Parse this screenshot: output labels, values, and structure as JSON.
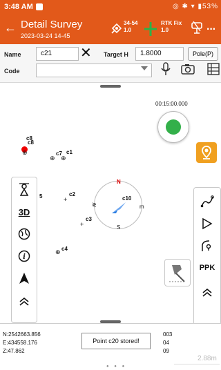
{
  "status": {
    "time": "3:48 AM",
    "right_text": "◎ ✱ ▾ ▮53%"
  },
  "header": {
    "title": "Detail Survey",
    "subtitle": "2023-03-24 14-45",
    "back_icon": "back-arrow-icon"
  },
  "satellite": {
    "count": "34-54",
    "value": "1.0"
  },
  "rtk": {
    "status": "RTK Fix",
    "value": "1.0"
  },
  "form": {
    "name_label": "Name",
    "name_value": "c21",
    "target_h_label": "Target H",
    "target_h_value": "1.8000",
    "pole_label": "Pole(P)",
    "code_label": "Code",
    "code_value": ""
  },
  "map": {
    "timer": "00:15:00.000",
    "compass": {
      "n": "N",
      "s": "S",
      "w": "≷",
      "m": "m"
    },
    "points": [
      {
        "id": "c8",
        "label": "c8"
      },
      {
        "id": "c8b",
        "label": "c8"
      },
      {
        "id": "c7",
        "label": "c7"
      },
      {
        "id": "c1",
        "label": "c1"
      },
      {
        "id": "c2",
        "label": "c2"
      },
      {
        "id": "c3",
        "label": "c3"
      },
      {
        "id": "c4",
        "label": "c4"
      },
      {
        "id": "c5",
        "label": "5"
      },
      {
        "id": "c10",
        "label": "c10"
      }
    ],
    "left_tools": [
      "person-height-icon",
      "3D",
      "globe-icon",
      "info-icon",
      "navigation-arrow-icon",
      "collapse-up-icon"
    ],
    "right_tools": [
      "line-icon",
      "play-icon",
      "curve-icon",
      "PPK",
      "collapse-up-icon"
    ],
    "ppk_label": "PPK",
    "view_3d_label": "3D"
  },
  "bottom": {
    "n": "N:2542663.856",
    "e": "E:434558.176",
    "z": "Z:47.862",
    "right1": "003",
    "right2": "04",
    "right3": "09",
    "toast": "Point c20 stored!",
    "distance": "2.88m"
  },
  "colors": {
    "header": "#e2591a",
    "pin_button": "#f0a020",
    "gnss_dot": "#33b04a"
  }
}
